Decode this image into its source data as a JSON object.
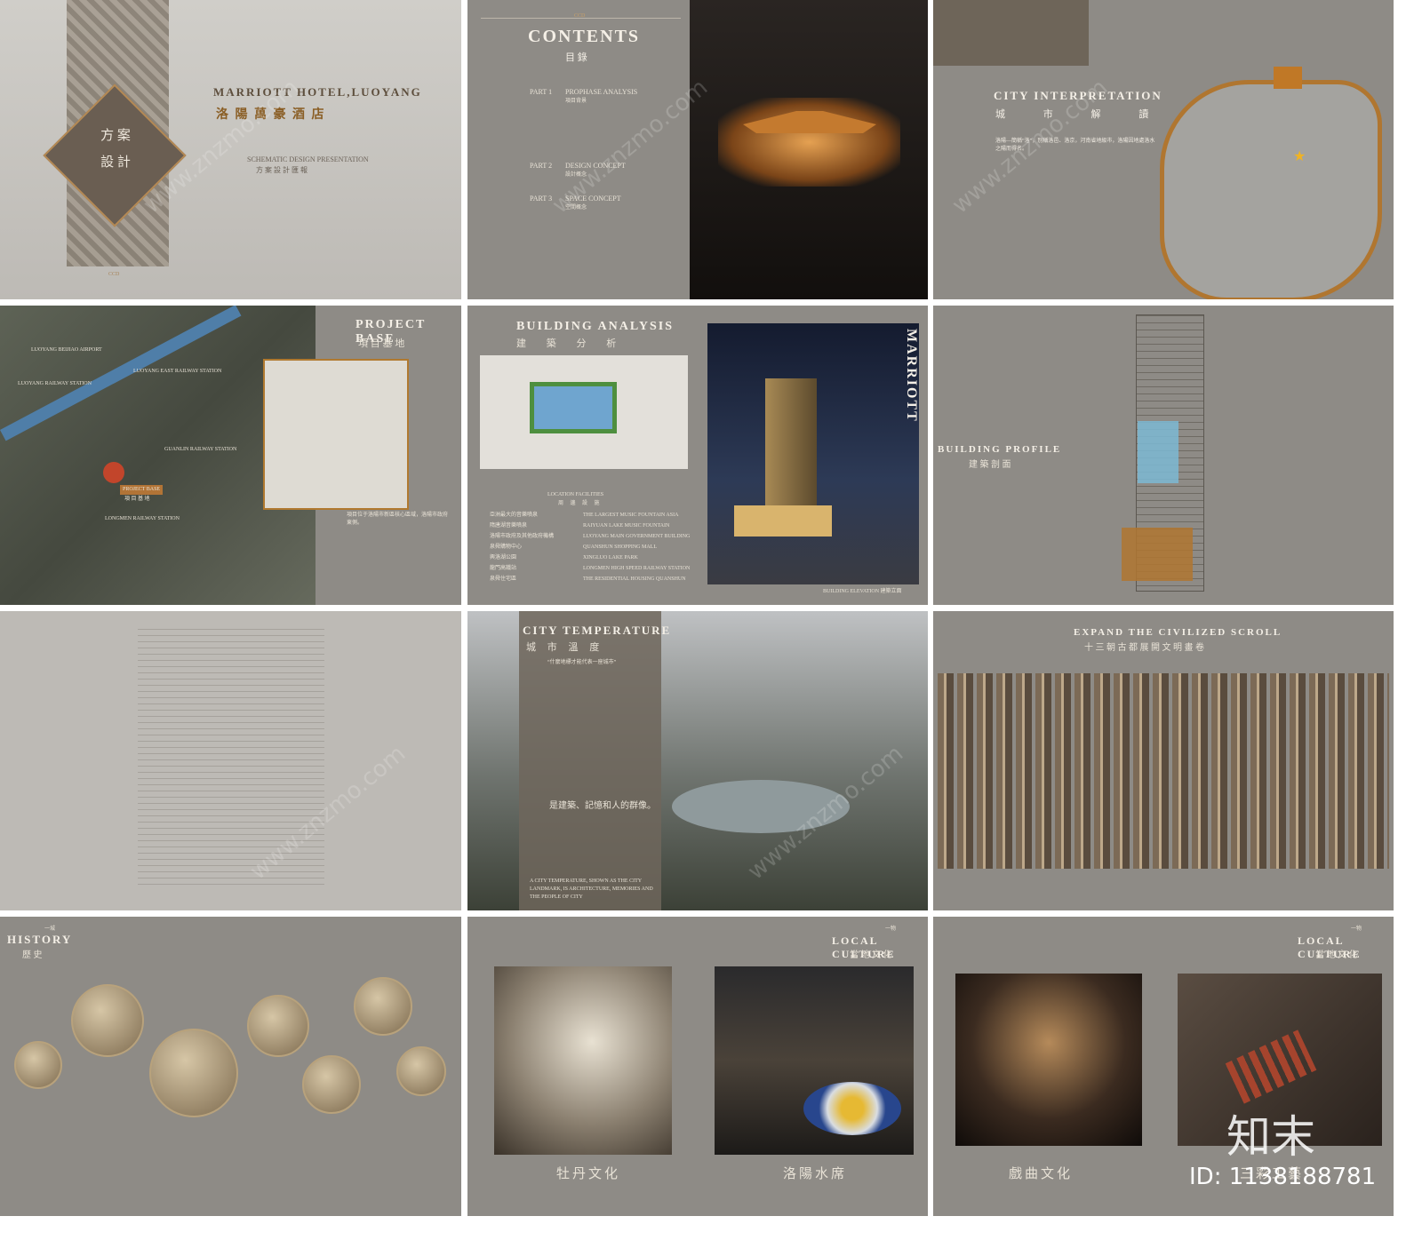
{
  "panels": {
    "p1": {
      "title_en": "MARRIOTT HOTEL,LUOYANG",
      "title_cn": "洛 陽 萬 豪 酒 店",
      "badge": "方 案\n設 計",
      "sub_en": "SCHEMATIC DESIGN PRESENTATION",
      "sub_cn": "方 案 設 計 匯 報",
      "footer": "CCD"
    },
    "p2": {
      "header": "CCD",
      "title_en": "CONTENTS",
      "title_cn": "目 錄",
      "parts": [
        {
          "label": "PART 1",
          "en": "PROPHASE ANALYSIS",
          "cn": "項目背景"
        },
        {
          "label": "PART 2",
          "en": "DESIGN CONCEPT",
          "cn": "設計概念"
        },
        {
          "label": "PART 3",
          "en": "SPACE CONCEPT",
          "cn": "空間概念"
        }
      ]
    },
    "p3": {
      "title_en": "CITY  INTERPRETATION",
      "title_cn": "城 市 解 讀",
      "body_cn": "洛陽—簡稱“洛”，別稱洛邑、洛京，河南省地級市，洛陽因地處洛水之陽而得名。"
    },
    "p4": {
      "title_en": "PROJECT BASE",
      "title_cn": "項 目 基 地",
      "map_labels": [
        "LUOYANG BEIJIAO AIRPORT",
        "LUOYANG RAILWAY STATION",
        "LUOYANG EAST RAILWAY STATION",
        "GUANLIN RAILWAY STATION",
        "LONGMEN RAILWAY STATION",
        "PROJECT BASE",
        "項 目 基 地"
      ],
      "body_cn": "項目位于洛陽市新區核心區域，洛陽市政府東側。"
    },
    "p5": {
      "title_en": "BUILDING ANALYSIS",
      "title_cn": "建 築 分 析",
      "loc_en": "LOCATION  FACILITIES",
      "loc_cn": "周 邊 設 施",
      "brand": "MARRIOTT",
      "caption": "BUILDING ELEVATION 建築立面",
      "facilities": [
        {
          "cn": "亞洲最大的音樂噴泉",
          "en": "THE LARGEST MUSIC FOUNTAIN ASIA"
        },
        {
          "cn": "隋唐湖音樂噴泉",
          "en": "RAIYUAN LAKE MUSIC FOUNTAIN"
        },
        {
          "cn": "洛陽市政府及其他政府機構",
          "en": "LUOYANG MAIN GOVERNMENT BUILDING"
        },
        {
          "cn": "泉舜購物中心",
          "en": "QUANSHUN SHOPPING MALL"
        },
        {
          "cn": "興洛湖公園",
          "en": "XINGLUO LAKE PARK"
        },
        {
          "cn": "龍門高鐵站",
          "en": "LONGMEN HIGH SPEED RAILWAY STATION"
        },
        {
          "cn": "泉舜住宅區",
          "en": "THE RESIDENTIAL HOUSING QUANSHUN"
        }
      ]
    },
    "p6": {
      "title_en": "BUILDING PROFILE",
      "title_cn": "建 築 剖 面"
    },
    "p8": {
      "title_en": "CITY TEMPERATURE",
      "title_cn": "城 市 溫 度",
      "quote": "“什麼地標才能代表一座城市”",
      "closing": "是建築、記憶和人的群像。",
      "closing_en": "A CITY TEMPERATURE, SHOWN AS THE CITY LANDMARK, IS ARCHITECTURE, MEMORIES AND THE PEOPLE OF CITY"
    },
    "p9": {
      "title_en": "EXPAND THE CIVILIZED SCROLL",
      "title_cn": "十 三 朝 古 都  展 開 文 明 畫 卷"
    },
    "p10": {
      "title_en": "HISTORY",
      "title_cn": "歷 史",
      "tag": "一城"
    },
    "p11": {
      "title_en": "LOCAL CULTURE",
      "title_cn": "當 地 文 化",
      "tag": "一物",
      "captions": [
        "牡丹文化",
        "洛陽水席"
      ]
    },
    "p12": {
      "title_en": "LOCAL CULTURE",
      "title_cn": "當 地 文 化",
      "tag": "一物",
      "captions": [
        "戲曲文化",
        "三彩工藝"
      ]
    }
  },
  "watermark": {
    "text": "www.znzmo.com",
    "brand": "知末",
    "id": "ID: 1138188781"
  },
  "colors": {
    "panel": "#8e8b86",
    "accent": "#b0742e",
    "text": "#f2ece0",
    "dark": "#2b2724",
    "blue": "#7db8d3"
  }
}
